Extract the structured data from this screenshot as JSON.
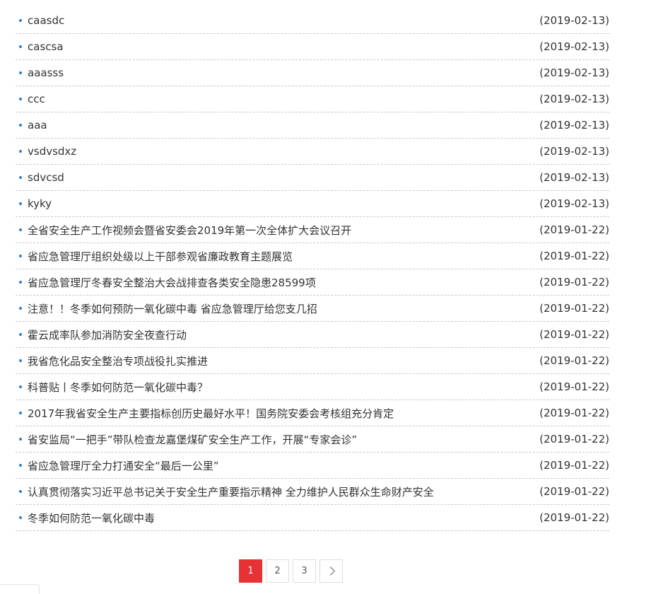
{
  "news": {
    "items": [
      {
        "title": "caasdc",
        "date": "(2019-02-13)"
      },
      {
        "title": "cascsa",
        "date": "(2019-02-13)"
      },
      {
        "title": "aaasss",
        "date": "(2019-02-13)"
      },
      {
        "title": "ccc",
        "date": "(2019-02-13)"
      },
      {
        "title": "aaa",
        "date": "(2019-02-13)"
      },
      {
        "title": "vsdvsdxz",
        "date": "(2019-02-13)"
      },
      {
        "title": "sdvcsd",
        "date": "(2019-02-13)"
      },
      {
        "title": "kyky",
        "date": "(2019-02-13)"
      },
      {
        "title": "全省安全生产工作视频会暨省安委会2019年第一次全体扩大会议召开",
        "date": "(2019-01-22)"
      },
      {
        "title": "省应急管理厅组织处级以上干部参观省廉政教育主题展览",
        "date": "(2019-01-22)"
      },
      {
        "title": "省应急管理厅冬春安全整治大会战排查各类安全隐患28599项",
        "date": "(2019-01-22)"
      },
      {
        "title": "注意！！冬季如何预防一氧化碳中毒 省应急管理厅给您支几招",
        "date": "(2019-01-22)"
      },
      {
        "title": "霍云成率队参加消防安全夜查行动",
        "date": "(2019-01-22)"
      },
      {
        "title": "我省危化品安全整治专项战役扎实推进",
        "date": "(2019-01-22)"
      },
      {
        "title": "科普贴丨冬季如何防范一氧化碳中毒？",
        "date": "(2019-01-22)"
      },
      {
        "title": "2017年我省安全生产主要指标创历史最好水平！国务院安委会考核组充分肯定",
        "date": "(2019-01-22)"
      },
      {
        "title": "省安监局“一把手”带队检查龙嘉堡煤矿安全生产工作，开展“专家会诊”",
        "date": "(2019-01-22)"
      },
      {
        "title": "省应急管理厅全力打通安全“最后一公里”",
        "date": "(2019-01-22)"
      },
      {
        "title": "认真贯彻落实习近平总书记关于安全生产重要指示精神 全力维护人民群众生命财产安全",
        "date": "(2019-01-22)"
      },
      {
        "title": "冬季如何防范一氧化碳中毒",
        "date": "(2019-01-22)"
      }
    ]
  },
  "pagination": {
    "pages": [
      "1",
      "2",
      "3"
    ],
    "current": "1",
    "next_icon": "chevron-right-icon"
  },
  "colors": {
    "bullet": "#2a7fc6",
    "active_page": "#e63235"
  }
}
